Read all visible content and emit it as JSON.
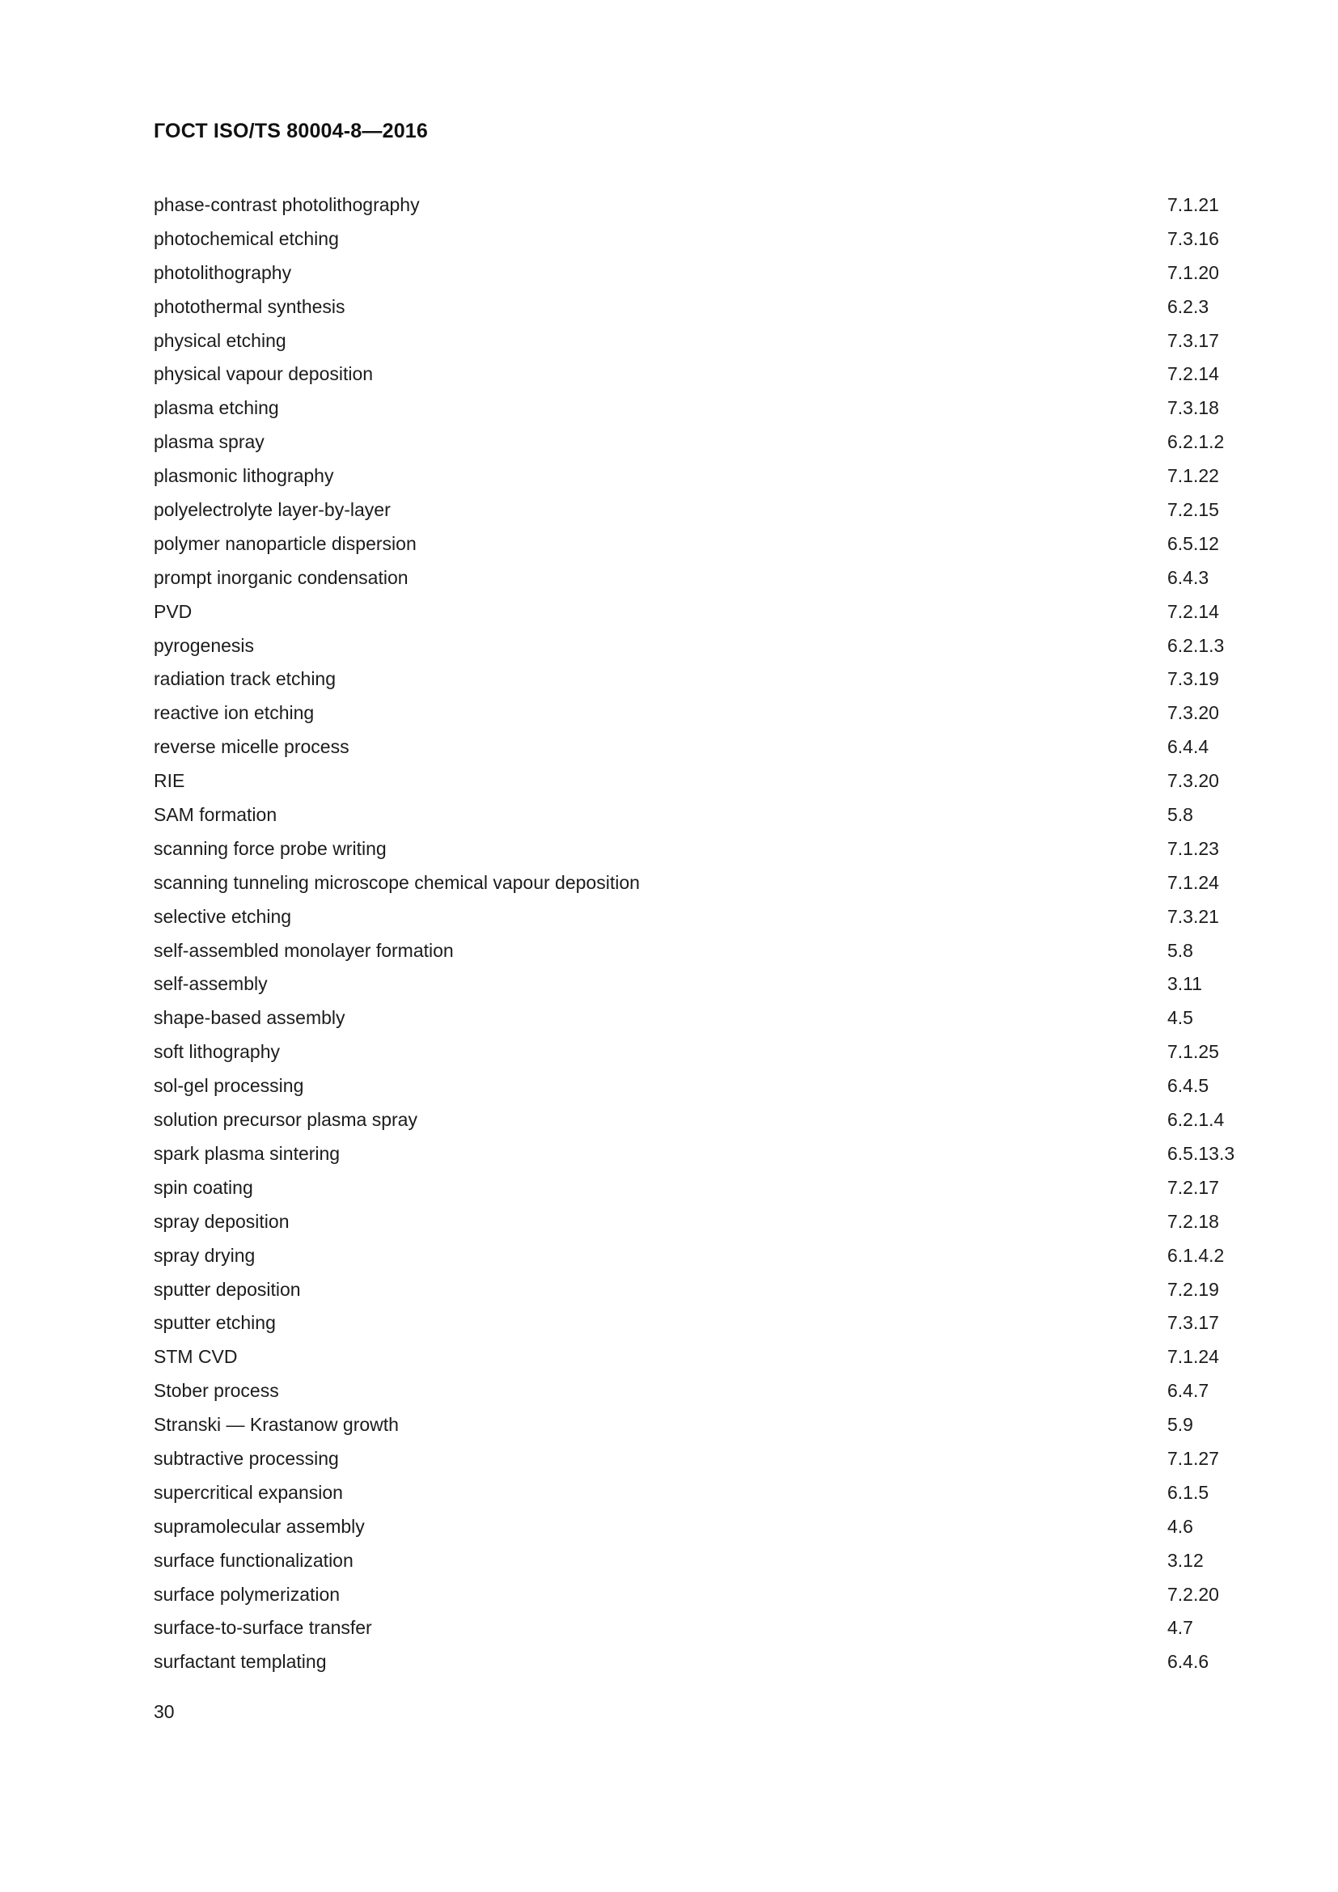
{
  "document": {
    "header": "ГОСТ ISO/TS 80004-8—2016",
    "page_number": "30"
  },
  "index": {
    "entries": [
      {
        "term": "phase-contrast photolithography",
        "ref": "7.1.21"
      },
      {
        "term": "photochemical etching",
        "ref": "7.3.16"
      },
      {
        "term": "photolithography",
        "ref": "7.1.20"
      },
      {
        "term": "photothermal synthesis",
        "ref": "6.2.3"
      },
      {
        "term": "physical etching",
        "ref": "7.3.17"
      },
      {
        "term": "physical vapour deposition",
        "ref": "7.2.14"
      },
      {
        "term": "plasma etching",
        "ref": "7.3.18"
      },
      {
        "term": "plasma spray",
        "ref": "6.2.1.2"
      },
      {
        "term": "plasmonic lithography",
        "ref": "7.1.22"
      },
      {
        "term": "polyelectrolyte layer-by-layer",
        "ref": "7.2.15"
      },
      {
        "term": "polymer nanoparticle dispersion",
        "ref": "6.5.12"
      },
      {
        "term": "prompt inorganic condensation",
        "ref": "6.4.3"
      },
      {
        "term": "PVD",
        "ref": "7.2.14"
      },
      {
        "term": "pyrogenesis",
        "ref": "6.2.1.3"
      },
      {
        "term": "radiation track etching",
        "ref": "7.3.19"
      },
      {
        "term": "reactive ion etching",
        "ref": "7.3.20"
      },
      {
        "term": "reverse micelle process",
        "ref": "6.4.4"
      },
      {
        "term": "RIE",
        "ref": "7.3.20"
      },
      {
        "term": "SAM formation",
        "ref": "5.8"
      },
      {
        "term": "scanning force probe writing",
        "ref": "7.1.23"
      },
      {
        "term": "scanning tunneling microscope chemical vapour deposition",
        "ref": "7.1.24"
      },
      {
        "term": "selective etching",
        "ref": "7.3.21"
      },
      {
        "term": "self-assembled monolayer formation",
        "ref": "5.8"
      },
      {
        "term": "self-assembly",
        "ref": "3.11"
      },
      {
        "term": "shape-based assembly",
        "ref": "4.5"
      },
      {
        "term": "soft lithography",
        "ref": "7.1.25"
      },
      {
        "term": "sol-gel processing",
        "ref": "6.4.5"
      },
      {
        "term": "solution precursor plasma spray",
        "ref": "6.2.1.4"
      },
      {
        "term": "spark plasma sintering",
        "ref": "6.5.13.3"
      },
      {
        "term": "spin coating",
        "ref": "7.2.17"
      },
      {
        "term": "spray deposition",
        "ref": "7.2.18"
      },
      {
        "term": "spray drying",
        "ref": "6.1.4.2"
      },
      {
        "term": "sputter deposition",
        "ref": "7.2.19"
      },
      {
        "term": "sputter etching",
        "ref": "7.3.17"
      },
      {
        "term": "STM CVD",
        "ref": "7.1.24"
      },
      {
        "term": "Stober process",
        "ref": "6.4.7"
      },
      {
        "term": "Stranski — Krastanow growth",
        "ref": "5.9"
      },
      {
        "term": "subtractive processing",
        "ref": "7.1.27"
      },
      {
        "term": "supercritical expansion",
        "ref": "6.1.5"
      },
      {
        "term": "supramolecular assembly",
        "ref": "4.6"
      },
      {
        "term": "surface functionalization",
        "ref": "3.12"
      },
      {
        "term": "surface polymerization",
        "ref": "7.2.20"
      },
      {
        "term": "surface-to-surface transfer",
        "ref": "4.7"
      },
      {
        "term": "surfactant templating",
        "ref": "6.4.6"
      }
    ]
  }
}
